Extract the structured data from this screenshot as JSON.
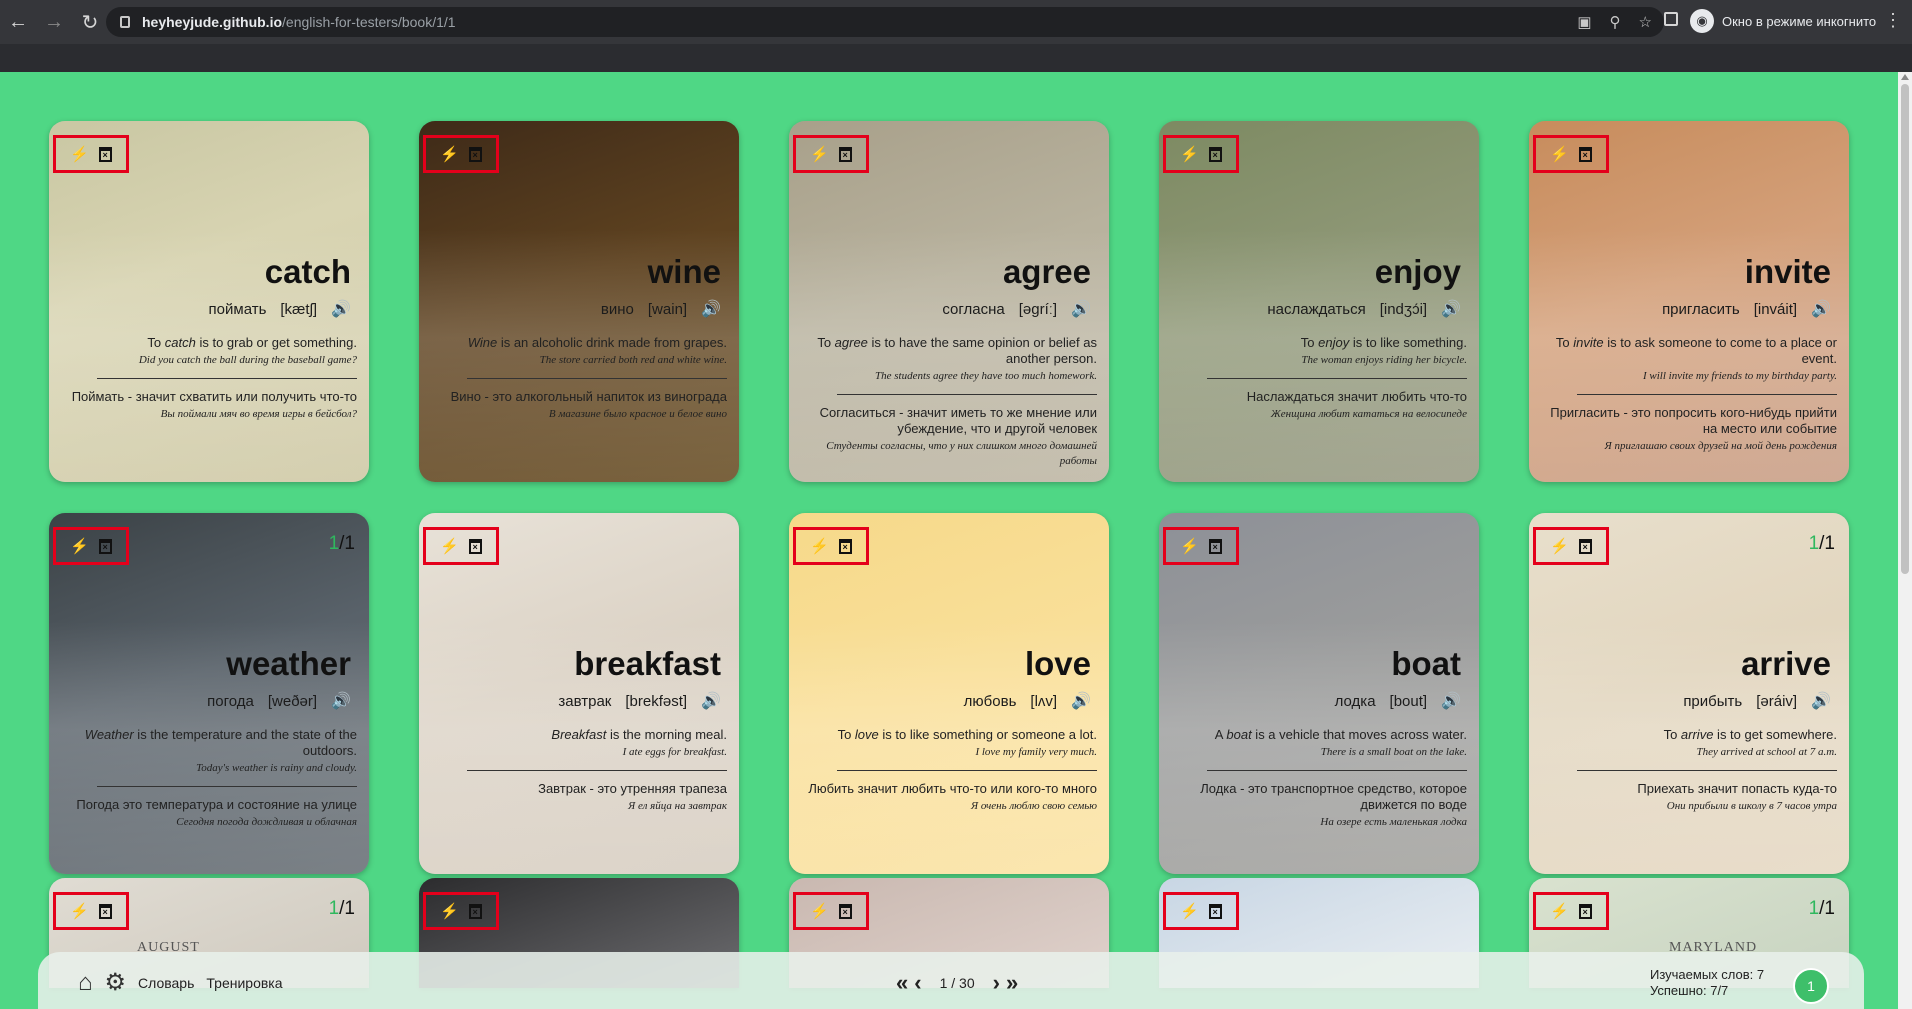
{
  "browser": {
    "url_host": "heyheyjude.github.io",
    "url_path": "/english-for-testers/book/1/1",
    "incognito_label": "Окно в режиме инкогнито"
  },
  "cards": [
    {
      "word": "catch",
      "translation": "поймать",
      "transcription": "[kætʃ]",
      "meaning_pre": "To ",
      "meaning_word": "catch",
      "meaning_post": " is to grab or get something.",
      "example": "Did you catch the ball during the baseball game?",
      "meaning_ru": "Поймать - значит схватить или получить что-то",
      "example_ru": "Вы поймали мяч во время игры в бейсбол?",
      "progress": ""
    },
    {
      "word": "wine",
      "translation": "вино",
      "transcription": "[wain]",
      "meaning_pre": "",
      "meaning_word": "Wine",
      "meaning_post": " is an alcoholic drink made from grapes.",
      "example": "The store carried both red and white wine.",
      "meaning_ru": "Вино - это алкогольный напиток из винограда",
      "example_ru": "В магазине было красное и белое вино",
      "progress": ""
    },
    {
      "word": "agree",
      "translation": "согласна",
      "transcription": "[əgríː]",
      "meaning_pre": "To ",
      "meaning_word": "agree",
      "meaning_post": " is to have the same opinion or belief as another person.",
      "example": "The students agree they have too much homework.",
      "meaning_ru": "Согласиться - значит иметь то же мнение или убеждение, что и другой человек",
      "example_ru": "Студенты согласны, что у них слишком много домашней работы",
      "progress": ""
    },
    {
      "word": "enjoy",
      "translation": "наслаждаться",
      "transcription": "[indʒɔ́i]",
      "meaning_pre": "To ",
      "meaning_word": "enjoy",
      "meaning_post": " is to like something.",
      "example": "The woman enjoys riding her bicycle.",
      "meaning_ru": "Наслаждаться значит любить что-то",
      "example_ru": "Женщина любит кататься на велосипеде",
      "progress": ""
    },
    {
      "word": "invite",
      "translation": "пригласить",
      "transcription": "[inváit]",
      "meaning_pre": "To ",
      "meaning_word": "invite",
      "meaning_post": " is to ask someone to come to a place or event.",
      "example": "I will invite my friends to my birthday party.",
      "meaning_ru": "Пригласить - это попросить кого-нибудь прийти на место или событие",
      "example_ru": "Я приглашаю своих друзей на мой день рождения",
      "progress": ""
    },
    {
      "word": "weather",
      "translation": "погода",
      "transcription": "[weðər]",
      "meaning_pre": "",
      "meaning_word": "Weather",
      "meaning_post": " is the temperature and the state of the outdoors.",
      "example": "Today's weather is rainy and cloudy.",
      "meaning_ru": "Погода это температура и состояние на улице",
      "example_ru": "Сегодня погода дождливая и облачная",
      "progress": "1"
    },
    {
      "word": "breakfast",
      "translation": "завтрак",
      "transcription": "[brekfəst]",
      "meaning_pre": "",
      "meaning_word": "Breakfast",
      "meaning_post": " is the morning meal.",
      "example": "I ate eggs for breakfast.",
      "meaning_ru": "Завтрак - это утренняя трапеза",
      "example_ru": "Я ел яйца на завтрак",
      "progress": ""
    },
    {
      "word": "love",
      "translation": "любовь",
      "transcription": "[lʌv]",
      "meaning_pre": "To ",
      "meaning_word": "love",
      "meaning_post": " is to like something or someone a lot.",
      "example": "I love my family very much.",
      "meaning_ru": "Любить значит любить что-то или кого-то много",
      "example_ru": "Я очень люблю свою семью",
      "progress": ""
    },
    {
      "word": "boat",
      "translation": "лодка",
      "transcription": "[bout]",
      "meaning_pre": "A ",
      "meaning_word": "boat",
      "meaning_post": " is a vehicle that moves across water.",
      "example": "There is a small boat on the lake.",
      "meaning_ru": "Лодка - это транспортное средство, которое движется по воде",
      "example_ru": "На озере есть маленькая лодка",
      "progress": ""
    },
    {
      "word": "arrive",
      "translation": "прибыть",
      "transcription": "[əráiv]",
      "meaning_pre": "To ",
      "meaning_word": "arrive",
      "meaning_post": " is to get somewhere.",
      "example": "They arrived at school at 7 a.m.",
      "meaning_ru": "Приехать значит попасть куда-то",
      "example_ru": "Они прибыли в школу в 7 часов утра",
      "progress": "1"
    }
  ],
  "partial_cards": [
    {
      "progress": "1",
      "label": "AUGUST"
    },
    {
      "progress": "",
      "label": ""
    },
    {
      "progress": "",
      "label": ""
    },
    {
      "progress": "",
      "label": ""
    },
    {
      "progress": "1",
      "label": "MARYLAND"
    }
  ],
  "progress_total": "1",
  "footer": {
    "dictionary_label": "Словарь",
    "training_label": "Тренировка",
    "page_label": "1 / 30",
    "learned_words": "Изучаемых слов: 7",
    "success": "Успешно: 7/7",
    "badge": "1"
  },
  "colors": {
    "page_bg": "#4fd785",
    "tool_frame": "#e4001b",
    "progress_done": "#2fb85e"
  }
}
